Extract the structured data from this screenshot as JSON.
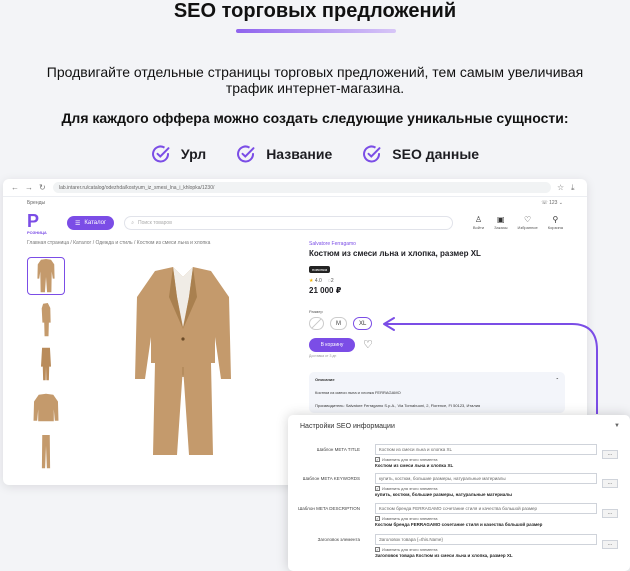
{
  "hero": {
    "title": "SEO торговых предложений",
    "subtitle": "Продвигайте отдельные страницы торговых предложений, тем самым увеличивая трафик интернет-магазина.",
    "bold_line": "Для каждого оффера можно создать следующие уникальные сущности:",
    "features": [
      "Урл",
      "Название",
      "SEO данные"
    ]
  },
  "browser": {
    "url": "lab.intarer.ru/catalog/odezhda/kostyum_iz_smesi_lna_i_khlopka/1230/"
  },
  "site": {
    "top_left": "Бренды",
    "top_right": "123",
    "logo_letter": "Р",
    "logo_text": "РОЗНИЦА",
    "catalog_label": "Каталог",
    "search_placeholder": "Поиск товаров",
    "head_icons": [
      "Войти",
      "Заказы",
      "Избранное",
      "Корзина"
    ],
    "breadcrumb": "Главная страница / Каталог / Одежда и стиль / Костюм из смеси льна и хлопка"
  },
  "product": {
    "brand": "Salvatore Ferragamo",
    "name": "Костюм из смеси льна и хлопка, размер XL",
    "badge": "новинка",
    "rating": "4.0",
    "reviews": "2",
    "price": "21 000 ₽",
    "size_label": "Размер",
    "sizes": [
      "M",
      "XL"
    ],
    "buy_label": "В корзину",
    "delivery": "Доставка от 3 дн",
    "desc_title": "Описание",
    "desc_text_1": "Костюм из смеси льна и хлопка FERRAGAMO",
    "desc_text_2": "Производитель: Salvatore Ferragamo S.p.A., Via Tornabuoni, 2, Florence, FI 50123, Италия",
    "suit_color": "#c49a6c"
  },
  "seo": {
    "title": "Настройки SEO информации",
    "button_label": "...",
    "check_label": "Изменить для этого элемента",
    "rows": [
      {
        "label": "Шаблон META TITLE",
        "value": "Костюм из смеси льна и хлопка XL",
        "result": "Костюм из смеси льна и хлопка XL"
      },
      {
        "label": "Шаблон META KEYWORDS",
        "value": "купить, костюм, большие размеры, натуральные материалы",
        "result": "купить, костюм, большие размеры, натуральные материалы"
      },
      {
        "label": "Шаблон META DESCRIPTION",
        "value": "Костюм бренда FERRAGAMO сочетание стиля и качества большой размер",
        "result": "Костюм бренда FERRAGAMO сочетание стиля и качества большой размер"
      },
      {
        "label": "Заголовок элемента",
        "value": "Заголовок товара {=this.Name}",
        "result": "Заголовок товара Костюм из смеси льна и хлопка, размер XL"
      }
    ]
  },
  "colors": {
    "accent": "#7b4de6",
    "check": "#7b4de6"
  }
}
